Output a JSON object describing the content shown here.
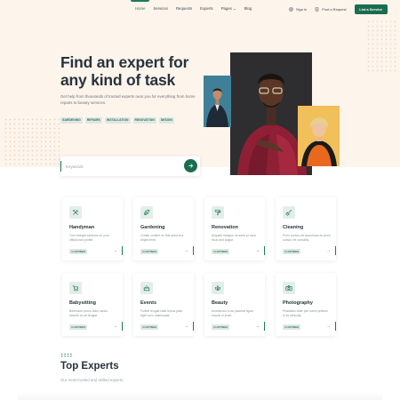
{
  "nav": {
    "links": [
      {
        "label": "Home",
        "active": true
      },
      {
        "label": "Services"
      },
      {
        "label": "Requests"
      },
      {
        "label": "Experts"
      },
      {
        "label": "Pages"
      },
      {
        "label": "Blog"
      }
    ],
    "pages_caret": "⌄",
    "sign_in": "Sign in",
    "post_request": "Post a Request",
    "list_service": "List a Service"
  },
  "hero": {
    "title": "Find an expert for any kind of task",
    "subtitle": "Get help from thousands of trusted experts near you for everything from home repairs to beauty services.",
    "tags": [
      "GARDENING",
      "REPAIRS",
      "INSTALLATION",
      "RENOVATION",
      "DESIGN"
    ],
    "search_placeholder": "Keywords"
  },
  "categories": [
    {
      "title": "Handyman",
      "desc": "Turn thought sections on your official and profile.",
      "badge": "4 LISTINGS",
      "icon": "tools-icon"
    },
    {
      "title": "Gardening",
      "desc": "Create content on first seed at a bright fresh.",
      "badge": "4 LISTINGS",
      "icon": "leaf-icon"
    },
    {
      "title": "Renovation",
      "desc": "Aliquam tristique sit amet pr nunc risus and augue.",
      "badge": "4 LISTINGS",
      "icon": "paint-roller-icon"
    },
    {
      "title": "Cleaning",
      "desc": "Proin cursus vel accumsan eu proin cursus vel convallis.",
      "badge": "4 LISTINGS",
      "icon": "broom-icon"
    },
    {
      "title": "Babysitting",
      "desc": "Bibendum purus diam varius lobortis at vel feugiat.",
      "badge": "4 LISTINGS",
      "icon": "stroller-icon"
    },
    {
      "title": "Events",
      "desc": "Fulfest feugiat vitae lectus justo eget nunc malesuada.",
      "badge": "4 LISTINGS",
      "icon": "cake-icon"
    },
    {
      "title": "Beauty",
      "desc": "Ameliorous in ac placerat ligula mauris in proin.",
      "badge": "4 LISTINGS",
      "icon": "lotus-icon"
    },
    {
      "title": "Photography",
      "desc": "Phasellus vitae pec lorem pretium in sit vehicula.",
      "badge": "4 LISTINGS",
      "icon": "camera-icon"
    }
  ],
  "card_arrow": "→",
  "experts": {
    "title": "Top Experts",
    "subtitle": "Our most trusted and skilled experts."
  },
  "colors": {
    "accent": "#1b6d4f",
    "hero_bg": "#fdf4ec",
    "tag_bg": "#dde9e2"
  }
}
